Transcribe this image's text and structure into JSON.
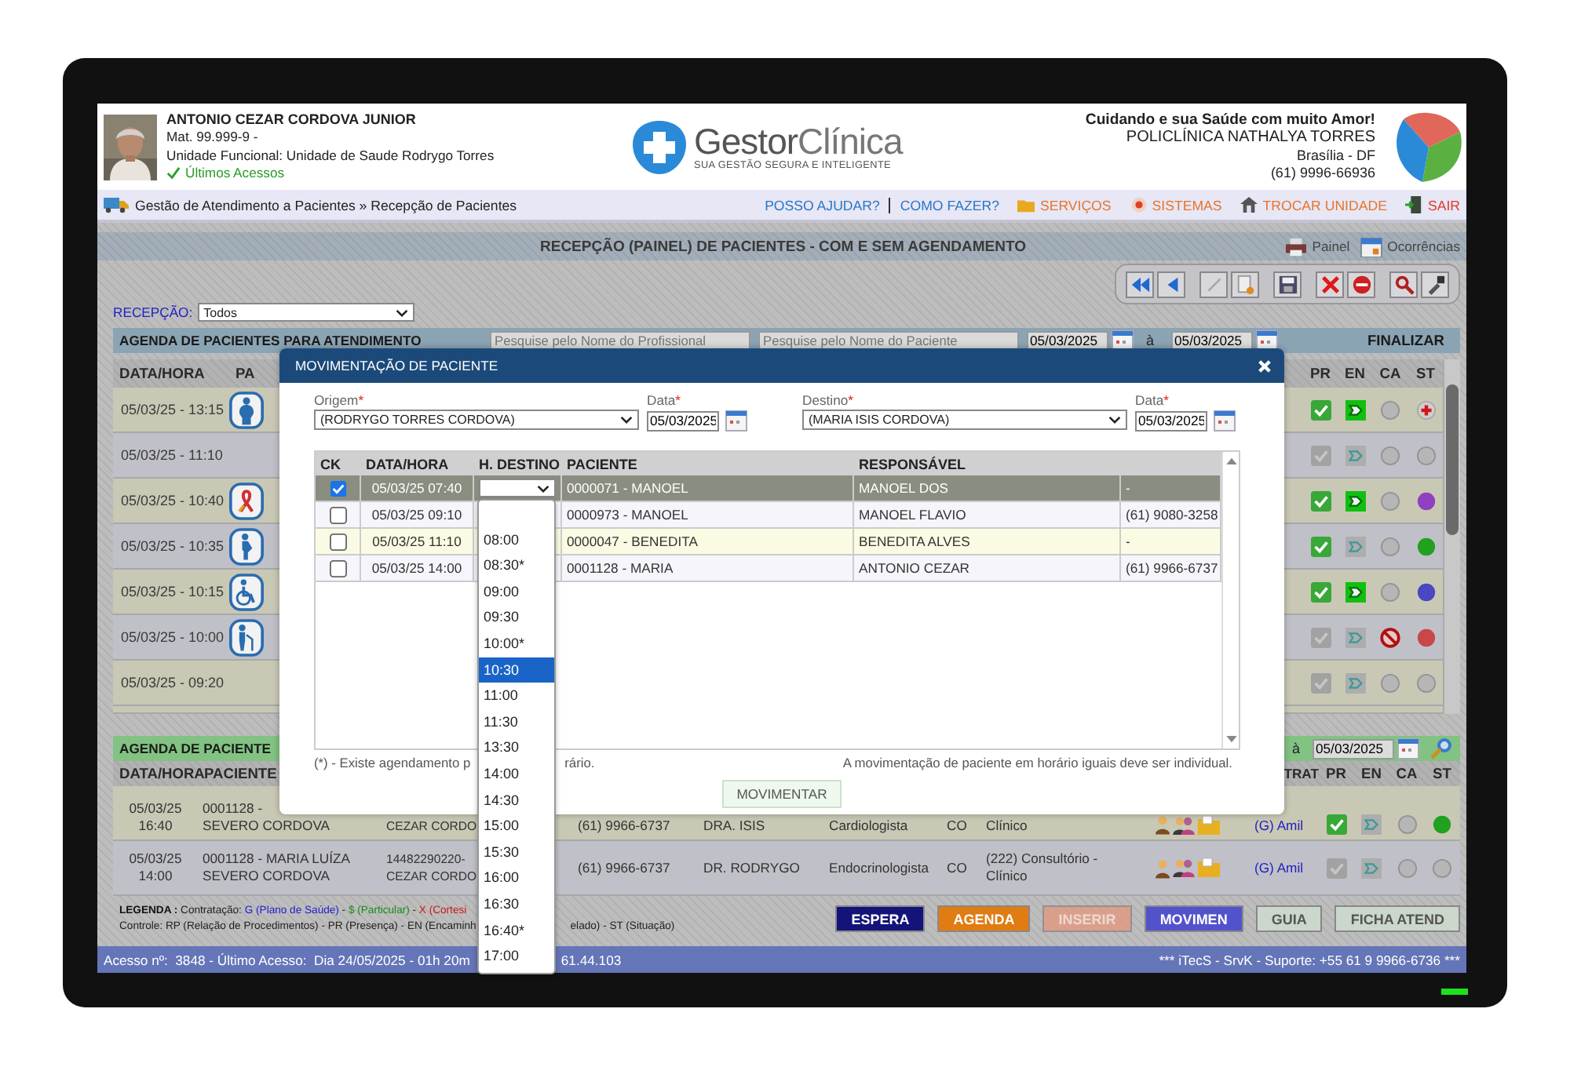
{
  "header": {
    "user_name": "ANTONIO CEZAR CORDOVA JUNIOR",
    "registration": "Mat. 99.999-9  -",
    "unit": "Unidade Funcional: Unidade de Saude Rodrygo Torres",
    "recent_link": "Últimos Acessos"
  },
  "brand": {
    "name_first": "Gestor",
    "name_second": "Clínica",
    "tagline": "SUA GESTÃO SEGURA E INTELIGENTE"
  },
  "clinic": {
    "slogan": "Cuidando e sua Saúde com muito Amor!",
    "name": "POLICLÍNICA NATHALYA TORRES",
    "city": "Brasília - DF",
    "phone": "(61) 9996-66936"
  },
  "nav": {
    "breadcrumb": "Gestão de Atendimento a Pacientes » Recepção de Pacientes",
    "links": [
      {
        "label": "POSSO AJUDAR?",
        "kind": "help"
      },
      {
        "label": "COMO FAZER?",
        "kind": "help"
      },
      {
        "label": "SERVIÇOS",
        "kind": "folder"
      },
      {
        "label": "SISTEMAS",
        "kind": "target"
      },
      {
        "label": "TROCAR UNIDADE",
        "kind": "house"
      },
      {
        "label": "SAIR",
        "kind": "exit"
      }
    ]
  },
  "page_title": "RECEPÇÃO (PAINEL) DE PACIENTES - COM E SEM AGENDAMENTO",
  "title_links": [
    {
      "label": "Painel",
      "kind": "printer"
    },
    {
      "label": "Ocorrências",
      "kind": "calendar"
    }
  ],
  "reception": {
    "label": "RECEPÇÃO:",
    "value": "Todos"
  },
  "agenda": {
    "title": "AGENDA DE PACIENTES PARA ATENDIMENTO",
    "professional_search": {
      "placeholder": "Pesquise pelo Nome do Profissional"
    },
    "patient_search": {
      "placeholder": "Pesquise pelo Nome do Paciente"
    },
    "date_from": "05/03/2025",
    "date_sep": "à",
    "date_to": "05/03/2025",
    "finalize": "FINALIZAR",
    "columns": [
      "DATA/HORA",
      "PA",
      "PR",
      "EN",
      "CA",
      "ST"
    ],
    "rows": [
      {
        "datetime": "05/03/25 - 13:15",
        "pa": {
          "kind": "obese"
        },
        "present": true,
        "forwarded": true,
        "cancelled": false,
        "status": {
          "kind": "cross"
        }
      },
      {
        "datetime": "05/03/25 - 11:10",
        "present": false,
        "forwarded": false,
        "cancelled": false,
        "status": {
          "kind": "none"
        }
      },
      {
        "datetime": "05/03/25 - 10:40",
        "pa": {
          "kind": "ribbon"
        },
        "present": true,
        "forwarded": true,
        "cancelled": false,
        "status": {
          "kind": "dot",
          "color": "#9040c0"
        }
      },
      {
        "datetime": "05/03/25 - 10:35",
        "pa": {
          "kind": "pregnant"
        },
        "present": true,
        "forwarded": false,
        "cancelled": false,
        "status": {
          "kind": "dot",
          "color": "#22a022"
        }
      },
      {
        "datetime": "05/03/25 - 10:15",
        "pa": {
          "kind": "wheelchair"
        },
        "present": true,
        "forwarded": true,
        "cancelled": false,
        "status": {
          "kind": "dot",
          "color": "#4848c0"
        }
      },
      {
        "datetime": "05/03/25 - 10:00",
        "pa": {
          "kind": "elderly"
        },
        "present": false,
        "forwarded": false,
        "cancelled": true,
        "status": {
          "kind": "dot",
          "color": "#c84848"
        }
      },
      {
        "datetime": "05/03/25 - 09:20",
        "present": false,
        "forwarded": false,
        "cancelled": false,
        "status": {
          "kind": "none"
        }
      }
    ]
  },
  "agenda2": {
    "title": "AGENDA DE PACIENTE",
    "date_sep": "à",
    "date_to": "05/03/2025",
    "columns": [
      "DATA/HORA",
      "PACIENTE",
      "TRAT",
      "PR",
      "EN",
      "CA",
      "ST"
    ],
    "rows": [
      {
        "datetime": [
          "05/03/25",
          "16:40"
        ],
        "patient": [
          "0001128 -",
          "SEVERO CORDOVA"
        ],
        "responsible": [
          "CEZAR CORDO"
        ],
        "phone": "(61) 9966-6737",
        "professional": "DRA. ISIS",
        "specialty": "Cardiologista",
        "type": "CO",
        "room": [
          "Clínico"
        ],
        "contract": "(G) Amil",
        "present": true,
        "forwarded": false,
        "cancelled": false,
        "status": {
          "kind": "dot",
          "color": "#22a022"
        }
      },
      {
        "datetime": [
          "05/03/25",
          "14:00"
        ],
        "patient": [
          "0001128 - MARIA LUÍZA",
          "SEVERO CORDOVA"
        ],
        "responsible": [
          "14482290220-",
          "CEZAR CORDO"
        ],
        "phone": "(61) 9966-6737",
        "professional": "DR. RODRYGO",
        "specialty": "Endocrinologista",
        "type": "CO",
        "room": [
          "(222) Consultório -",
          "Clínico"
        ],
        "contract": "(G) Amil",
        "present": false,
        "forwarded": false,
        "cancelled": false,
        "status": {
          "kind": "none"
        }
      }
    ]
  },
  "legend": {
    "line1": [
      {
        "text": "LEGENDA :",
        "kind": "label"
      },
      {
        "text": " Contratação: ",
        "kind": "plain"
      },
      {
        "text": "G (Plano de Saúde)",
        "kind": "plan"
      },
      {
        "text": " - ",
        "kind": "plain"
      },
      {
        "text": "$ (Particular)",
        "kind": "private"
      },
      {
        "text": " - ",
        "kind": "plain"
      },
      {
        "text": "X (Cortesi",
        "kind": "courtesy"
      }
    ],
    "line2_start": "Controle: RP (Relação de Procedimentos) - PR (Presença) - EN (Encaminh",
    "line2_end": "elado) - ST (Situação)"
  },
  "actions": [
    {
      "label": "ESPERA",
      "kind": "wait",
      "disabled": false
    },
    {
      "label": "AGENDA",
      "kind": "schedule",
      "disabled": false
    },
    {
      "label": "INSERIR",
      "kind": "insert",
      "disabled": true
    },
    {
      "label": "MOVIMEN",
      "kind": "move",
      "disabled": false
    },
    {
      "label": "GUIA",
      "kind": "light",
      "disabled": false
    },
    {
      "label": "FICHA ATEND",
      "kind": "light",
      "disabled": false
    }
  ],
  "status_bar": {
    "left": "Acesso nº:  3848 - Último Acesso:  Dia 24/05/2025 - 01h 20m",
    "left_end": "61.44.103",
    "right": "*** iTecS - SrvK - Suporte: +55 61 9 9966-6736 ***"
  },
  "modal": {
    "title": "MOVIMENTAÇÃO DE PACIENTE",
    "required_mark": "*",
    "origin": {
      "label": "Origem",
      "value": "(RODRYGO TORRES CORDOVA)"
    },
    "origin_date": {
      "label": "Data",
      "value": "05/03/2025"
    },
    "destination": {
      "label": "Destino",
      "value": "(MARIA ISIS CORDOVA)"
    },
    "destination_date": {
      "label": "Data",
      "value": "05/03/2025"
    },
    "columns": [
      "CK",
      "DATA/HORA",
      "H. DESTINO",
      "PACIENTE",
      "RESPONSÁVEL"
    ],
    "rows": [
      {
        "checked": true,
        "selected": true,
        "highlighted": false,
        "datetime": "05/03/25 07:40",
        "patient": "0000071 - MANOEL",
        "responsible": "MANOEL DOS",
        "phone": "-"
      },
      {
        "checked": false,
        "selected": false,
        "highlighted": false,
        "datetime": "05/03/25 09:10",
        "patient": "0000973 - MANOEL",
        "responsible": "MANOEL FLAVIO",
        "phone": "(61) 9080-3258"
      },
      {
        "checked": false,
        "selected": false,
        "highlighted": true,
        "datetime": "05/03/25 11:10",
        "patient": "0000047 - BENEDITA",
        "responsible": "BENEDITA ALVES",
        "phone": "-"
      },
      {
        "checked": false,
        "selected": false,
        "highlighted": false,
        "datetime": "05/03/25 14:00",
        "patient": "0001128 - MARIA",
        "responsible": "ANTONIO CEZAR",
        "phone": "(61) 9966-6737"
      }
    ],
    "time_options": [
      {
        "label": "08:00",
        "selected": false
      },
      {
        "label": "08:30*",
        "selected": false
      },
      {
        "label": "09:00",
        "selected": false
      },
      {
        "label": "09:30",
        "selected": false
      },
      {
        "label": "10:00*",
        "selected": false
      },
      {
        "label": "10:30",
        "selected": true
      },
      {
        "label": "11:00",
        "selected": false
      },
      {
        "label": "11:30",
        "selected": false
      },
      {
        "label": "13:30",
        "selected": false
      },
      {
        "label": "14:00",
        "selected": false
      },
      {
        "label": "14:30",
        "selected": false
      },
      {
        "label": "15:00",
        "selected": false
      },
      {
        "label": "15:30",
        "selected": false
      },
      {
        "label": "16:00",
        "selected": false
      },
      {
        "label": "16:30",
        "selected": false
      },
      {
        "label": "16:40*",
        "selected": false
      },
      {
        "label": "17:00",
        "selected": false
      }
    ],
    "footnote_start": "(*) - Existe agendamento p",
    "footnote_end": "rário.",
    "note": "A movimentação de paciente em horário iguais deve ser individual.",
    "submit": "MOVIMENTAR"
  }
}
